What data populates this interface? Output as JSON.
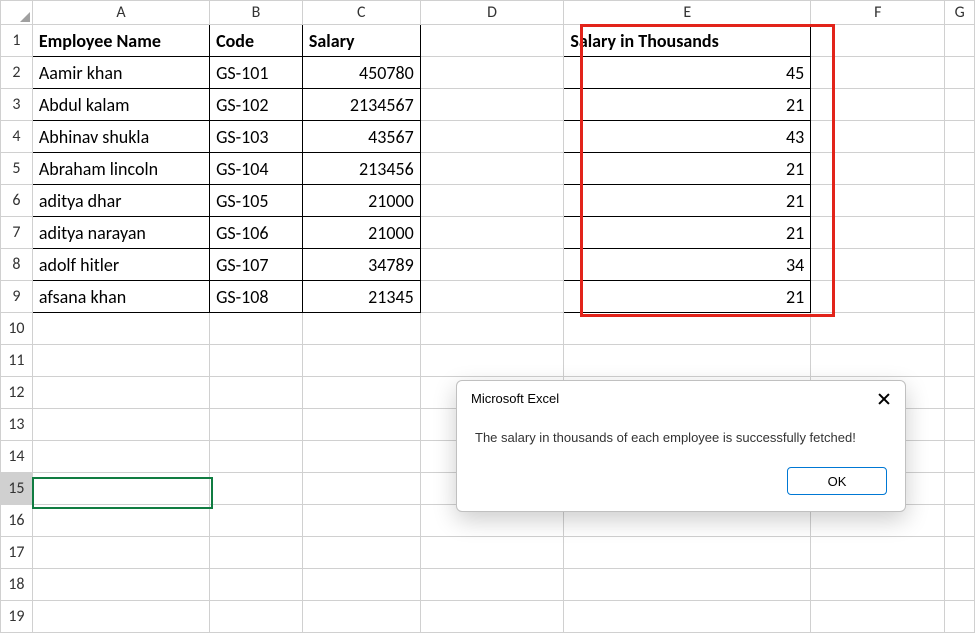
{
  "columns": [
    "A",
    "B",
    "C",
    "D",
    "E",
    "F",
    "G"
  ],
  "headers": {
    "A": "Employee Name",
    "B": "Code",
    "C": "Salary",
    "E": "Salary in Thousands"
  },
  "rows": [
    {
      "name": "Aamir khan",
      "code": "GS-101",
      "salary": "450780",
      "sal_k": "45"
    },
    {
      "name": "Abdul kalam",
      "code": "GS-102",
      "salary": "2134567",
      "sal_k": "21"
    },
    {
      "name": "Abhinav shukla",
      "code": "GS-103",
      "salary": "43567",
      "sal_k": "43"
    },
    {
      "name": "Abraham lincoln",
      "code": "GS-104",
      "salary": "213456",
      "sal_k": "21"
    },
    {
      "name": "aditya dhar",
      "code": "GS-105",
      "salary": "21000",
      "sal_k": "21"
    },
    {
      "name": "aditya narayan",
      "code": "GS-106",
      "salary": "21000",
      "sal_k": "21"
    },
    {
      "name": "adolf hitler",
      "code": "GS-107",
      "salary": "34789",
      "sal_k": "34"
    },
    {
      "name": "afsana khan",
      "code": "GS-108",
      "salary": "21345",
      "sal_k": "21"
    }
  ],
  "dialog": {
    "title": "Microsoft Excel",
    "message": "The salary in thousands of each employee is successfully fetched!",
    "ok": "OK"
  }
}
